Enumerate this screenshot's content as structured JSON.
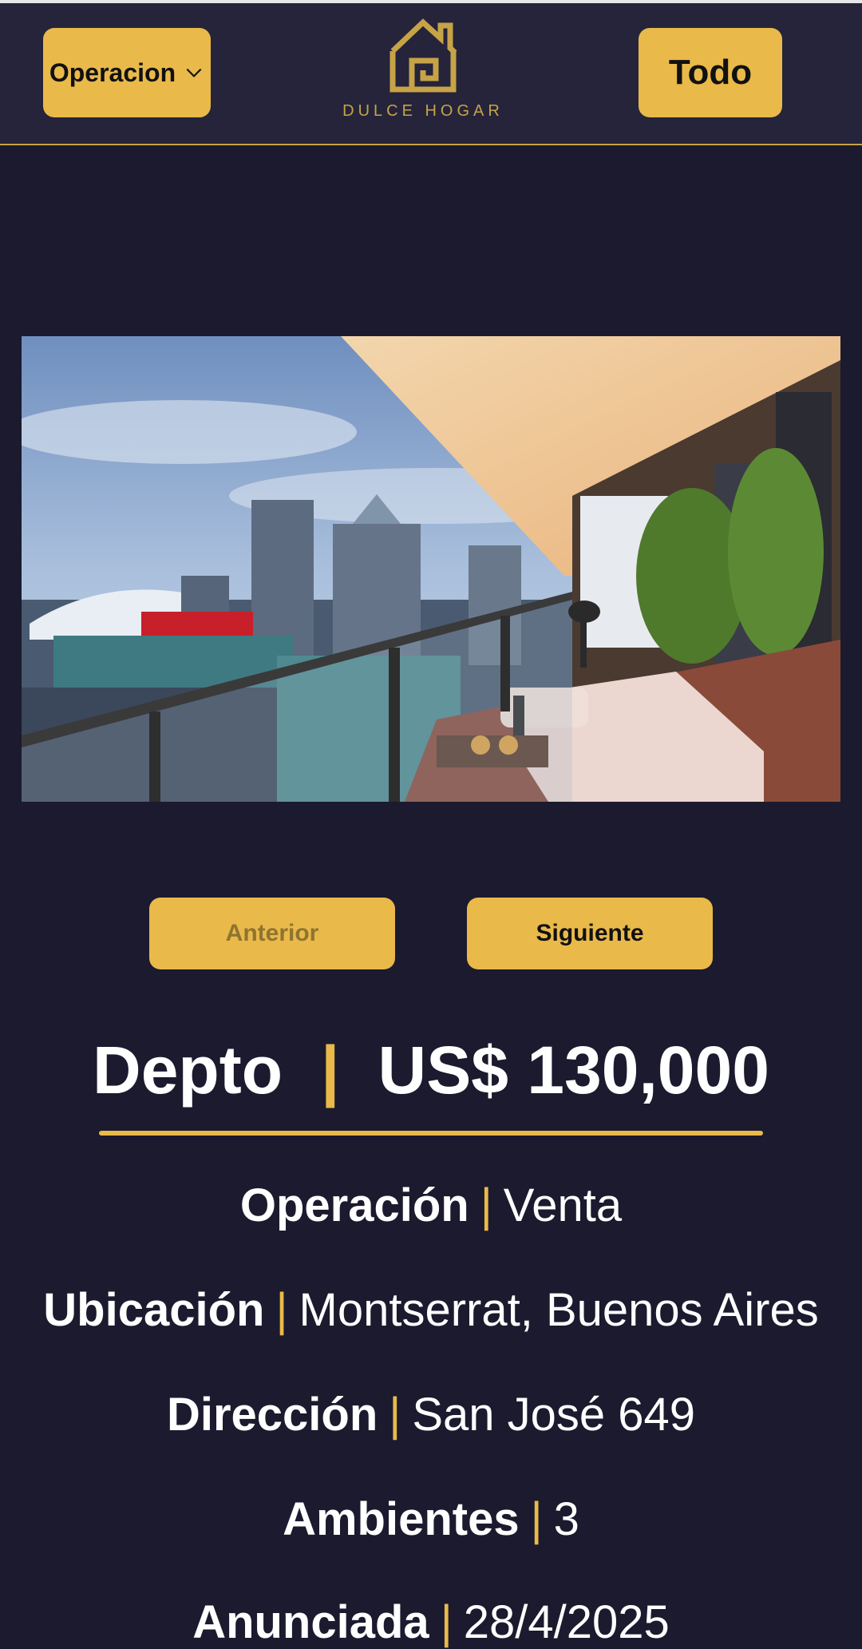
{
  "header": {
    "operation_label": "Operacion",
    "brand_name": "DULCE HOGAR",
    "all_label": "Todo"
  },
  "gallery": {
    "prev_label": "Anterior",
    "next_label": "Siguiente"
  },
  "listing": {
    "type": "Depto",
    "price": "US$ 130,000",
    "details": [
      {
        "key": "Operación",
        "value": "Venta"
      },
      {
        "key": "Ubicación",
        "value": "Montserrat, Buenos Aires"
      },
      {
        "key": "Dirección",
        "value": "San José 649"
      },
      {
        "key": "Ambientes",
        "value": "3"
      },
      {
        "key": "Anunciada",
        "value": "28/4/2025"
      }
    ]
  },
  "colors": {
    "background": "#1b1a2e",
    "header": "#25243a",
    "accent": "#e9b94a"
  }
}
